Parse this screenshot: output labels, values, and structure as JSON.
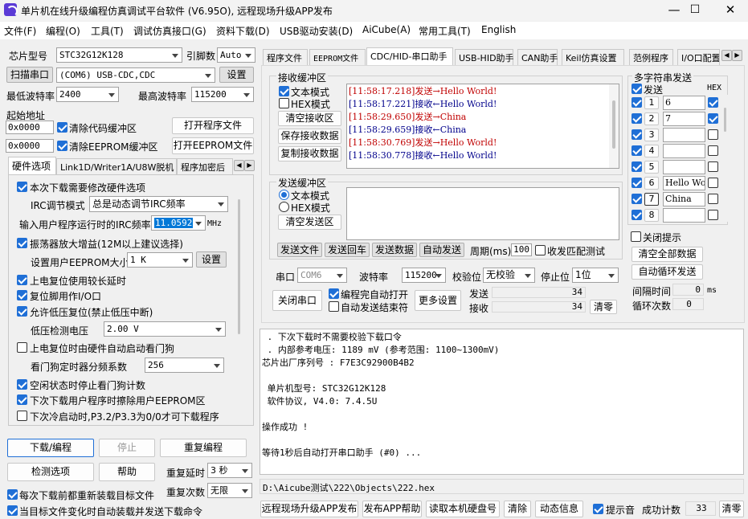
{
  "window": {
    "title": "单片机在线升级编程仿真调试平台软件 (V6.95O), 远程现场升级APP发布",
    "min": "—",
    "max": "☐",
    "close": "✕"
  },
  "menu": [
    "文件(F)",
    "编程(O)",
    "工具(T)",
    "调试仿真接口(G)",
    "资料下载(D)",
    "USB驱动安装(D)",
    "AiCube(A)",
    "常用工具(T)",
    "English"
  ],
  "left": {
    "chip_label": "芯片型号",
    "chip_value": "STC32G12K128",
    "pins_label": "引脚数",
    "pins_value": "Auto",
    "scan_btn": "扫描串口",
    "port_value": "(COM6) USB-CDC,CDC",
    "settings_btn": "设置",
    "min_baud_label": "最低波特率",
    "min_baud": "2400",
    "max_baud_label": "最高波特率",
    "max_baud": "115200",
    "start_addr_label": "起始地址",
    "addr1": "0x0000",
    "clear_code": "清除代码缓冲区",
    "open_prog": "打开程序文件",
    "addr2": "0x0000",
    "clear_eeprom": "清除EEPROM缓冲区",
    "open_eeprom": "打开EEPROM文件",
    "tabs": [
      "硬件选项",
      "Link1D/Writer1A/U8W脱机",
      "程序加密后"
    ],
    "opts": {
      "o1": "本次下载需要修改硬件选项",
      "irc_mode_label": "IRC调节模式",
      "irc_mode": "总是动态调节IRC频率",
      "irc_freq_label": "输入用户程序运行时的IRC频率",
      "irc_freq": "11.0592",
      "mhz": "MHz",
      "o2": "振荡器放大增益(12M以上建议选择)",
      "eeprom_size_label": "设置用户EEPROM大小",
      "eeprom_size": "1   K",
      "eeprom_set": "设置",
      "o3": "上电复位使用较长延时",
      "o4": "复位脚用作I/O口",
      "o5": "允许低压复位(禁止低压中断)",
      "lvd_label": "低压检测电压",
      "lvd": "2.00 V",
      "o6": "上电复位时由硬件自动启动看门狗",
      "wdt_label": "看门狗定时器分频系数",
      "wdt": "256",
      "o7": "空闲状态时停止看门狗计数",
      "o8": "下次下载用户程序时擦除用户EEPROM区",
      "o9": "下次冷启动时,P3.2/P3.3为0/0才可下载程序"
    },
    "download_btn": "下载/编程",
    "stop_btn": "停止",
    "reprog_btn": "重复编程",
    "check_btn": "检测选项",
    "help_btn": "帮助",
    "repeat_delay_label": "重复延时",
    "repeat_delay": "3 秒",
    "reload_each": "每次下载前都重新装载目标文件",
    "repeat_count_label": "重复次数",
    "repeat_count": "无限",
    "reload_change": "当目标文件变化时自动装载并发送下载命令"
  },
  "right": {
    "tabs": [
      "程序文件",
      "EEPROM文件",
      "CDC/HID-串口助手",
      "USB-HID助手",
      "CAN助手",
      "Keil仿真设置",
      "范例程序",
      "I/O口配置"
    ],
    "rx_group": "接收缓冲区",
    "rx_text": "文本模式",
    "rx_hex": "HEX模式",
    "rx_clear": "清空接收区",
    "rx_save": "保存接收数据",
    "rx_copy": "复制接收数据",
    "log": [
      {
        "time": "[11:58:17.218]",
        "dir": "发送→",
        "msg": "Hello World!",
        "color": "#c00000"
      },
      {
        "time": "[11:58:17.221]",
        "dir": "接收←",
        "msg": "Hello World!",
        "color": "#00008b"
      },
      {
        "time": "[11:58:29.650]",
        "dir": "发送→",
        "msg": "China",
        "color": "#c00000"
      },
      {
        "time": "[11:58:29.659]",
        "dir": "接收←",
        "msg": "China",
        "color": "#00008b"
      },
      {
        "time": "[11:58:30.769]",
        "dir": "发送→",
        "msg": "Hello World!",
        "color": "#c00000"
      },
      {
        "time": "[11:58:30.778]",
        "dir": "接收←",
        "msg": "Hello World!",
        "color": "#00008b"
      }
    ],
    "tx_group": "发送缓冲区",
    "tx_text": "文本模式",
    "tx_hex": "HEX模式",
    "tx_clear": "清空发送区",
    "send_file": "发送文件",
    "send_back": "发送回车",
    "send_data": "发送数据",
    "auto_send": "自动发送",
    "period_label": "周期(ms)",
    "period": "100",
    "match_label": "收发匹配测试",
    "port_label": "串口",
    "port": "COM6",
    "baud_label": "波特率",
    "baud": "115200",
    "parity_label": "校验位",
    "parity": "无校验",
    "stop_label": "停止位",
    "stop": "1位",
    "close_port": "关闭串口",
    "auto_open": "编程完自动打开",
    "auto_send_end": "自动发送结束符",
    "more": "更多设置",
    "send_label": "发送",
    "send_count": "34",
    "recv_label": "接收",
    "recv_count": "34",
    "clear_count": "清零",
    "multi_title": "多字符串发送",
    "multi_send": "发送",
    "multi_hex": "HEX",
    "multi": [
      {
        "n": "1",
        "text": "6",
        "hex": true
      },
      {
        "n": "2",
        "text": "7",
        "hex": true
      },
      {
        "n": "3",
        "text": "",
        "hex": false
      },
      {
        "n": "4",
        "text": "",
        "hex": false
      },
      {
        "n": "5",
        "text": "",
        "hex": false
      },
      {
        "n": "6",
        "text": "Hello Wo",
        "hex": false
      },
      {
        "n": "7",
        "text": "China",
        "hex": false
      },
      {
        "n": "8",
        "text": "",
        "hex": false
      }
    ],
    "close_tip": "关闭提示",
    "clear_all": "清空全部数据",
    "auto_loop": "自动循环发送",
    "interval_label": "间隔时间",
    "interval": "0",
    "ms": "ms",
    "loop_label": "循环次数",
    "loop": "0"
  },
  "output": {
    "lines": [
      " . 下次下载时不需要校验下载口令",
      " . 内部参考电压: 1189 mV (参考范围: 1100~1300mV)",
      "芯片出厂序列号 : F7E3C92900B4B2",
      "",
      " 单片机型号: STC32G12K128",
      " 软件协议, V4.0: 7.4.5U",
      "",
      "操作成功 !",
      "",
      "等待1秒后自动打开串口助手 (#0) ..."
    ],
    "path": "D:\\Aicube测试\\222\\Objects\\222.hex"
  },
  "bottom": {
    "remote": "远程现场升级APP发布",
    "publish": "发布APP帮助",
    "read_disk": "读取本机硬盘号",
    "clear": "清除",
    "dynamic": "动态信息",
    "beep": "提示音",
    "success_label": "成功计数",
    "success": "33",
    "zero": "清零"
  },
  "colors": {
    "accent": "#1f6fd6",
    "send": "#c00000",
    "recv": "#00008b"
  }
}
